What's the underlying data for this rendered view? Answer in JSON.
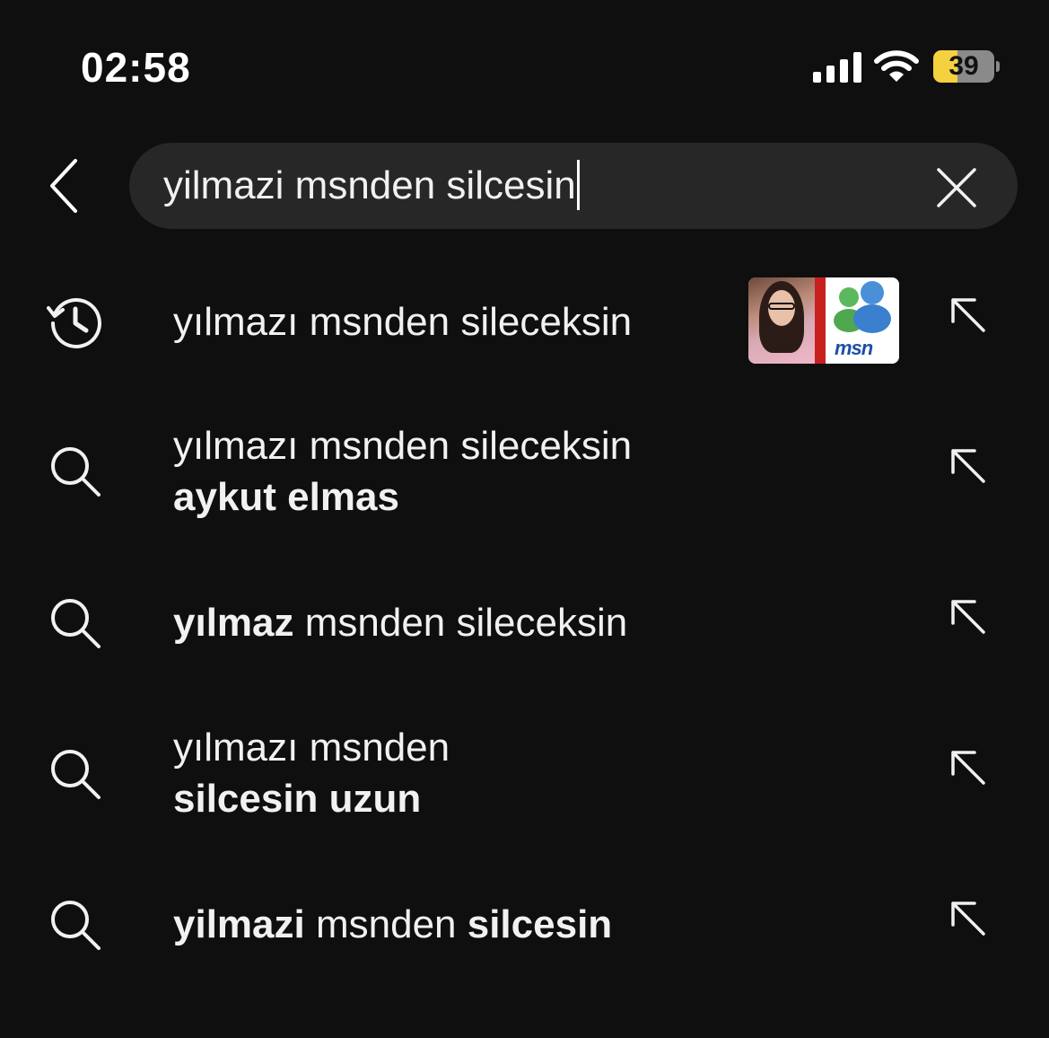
{
  "status_bar": {
    "time": "02:58",
    "battery_level": "39",
    "battery_fraction": 0.39,
    "icons": [
      "signal-icon",
      "wifi-icon",
      "battery-icon"
    ]
  },
  "search": {
    "query": "yilmazi msnden silcesin",
    "icons": {
      "back": "chevron-left-icon",
      "clear": "close-icon"
    }
  },
  "suggestions": [
    {
      "type": "history",
      "icon": "history-icon",
      "has_thumbnail": true,
      "thumbnail_label": "msn",
      "lines": [
        [
          {
            "text": "yılmazı msnden sileceksin",
            "bold": false
          }
        ]
      ]
    },
    {
      "type": "search",
      "icon": "search-icon",
      "lines": [
        [
          {
            "text": "yılmazı msnden sileceksin",
            "bold": false
          }
        ],
        [
          {
            "text": "aykut elmas",
            "bold": true
          }
        ]
      ]
    },
    {
      "type": "search",
      "icon": "search-icon",
      "lines": [
        [
          {
            "text": "yılmaz",
            "bold": true
          },
          {
            "text": " msnden sileceksin",
            "bold": false
          }
        ]
      ]
    },
    {
      "type": "search",
      "icon": "search-icon",
      "lines": [
        [
          {
            "text": "yılmazı msnden",
            "bold": false
          }
        ],
        [
          {
            "text": "silcesin uzun",
            "bold": true
          }
        ]
      ]
    },
    {
      "type": "search",
      "icon": "search-icon",
      "lines": [
        [
          {
            "text": "yilmazi",
            "bold": true
          },
          {
            "text": " msnden ",
            "bold": false
          },
          {
            "text": "silcesin",
            "bold": true
          }
        ]
      ]
    }
  ],
  "colors": {
    "background": "#0f0f0f",
    "search_box": "#272727",
    "text": "#f1f1f1",
    "battery_fill": "#f5d03f"
  }
}
